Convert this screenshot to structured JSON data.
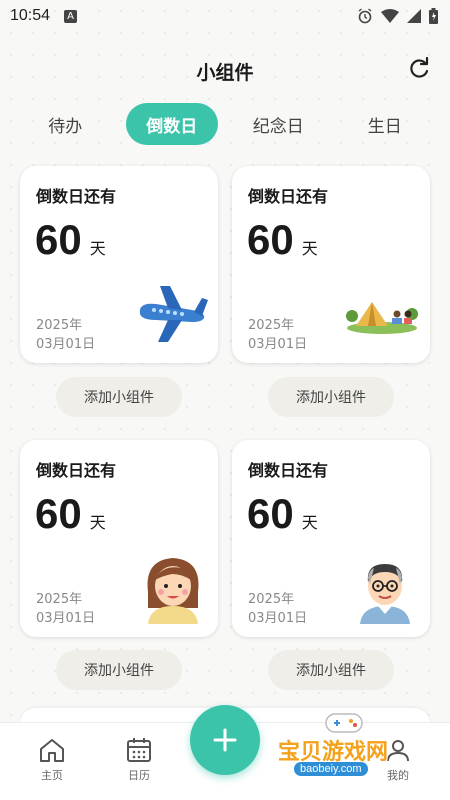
{
  "status_bar": {
    "time": "10:54",
    "a_icon": "A"
  },
  "header": {
    "title": "小组件",
    "refresh_icon": "refresh-icon"
  },
  "tabs": [
    {
      "label": "待办",
      "active": false
    },
    {
      "label": "倒数日",
      "active": true
    },
    {
      "label": "纪念日",
      "active": false
    },
    {
      "label": "生日",
      "active": false
    }
  ],
  "cards": [
    {
      "title": "倒数日还有",
      "count": "60",
      "unit": "天",
      "year": "2025年",
      "date": "03月01日",
      "illustration": "airplane"
    },
    {
      "title": "倒数日还有",
      "count": "60",
      "unit": "天",
      "year": "2025年",
      "date": "03月01日",
      "illustration": "camping"
    },
    {
      "title": "倒数日还有",
      "count": "60",
      "unit": "天",
      "year": "2025年",
      "date": "03月01日",
      "illustration": "girl"
    },
    {
      "title": "倒数日还有",
      "count": "60",
      "unit": "天",
      "year": "2025年",
      "date": "03月01日",
      "illustration": "old-man"
    }
  ],
  "add_widget_label": "添加小组件",
  "bottom_nav": [
    {
      "label": "主页",
      "icon": "home-icon"
    },
    {
      "label": "日历",
      "icon": "calendar-icon"
    },
    {
      "label": "我的",
      "icon": "profile-icon"
    }
  ],
  "fab_icon": "plus-icon",
  "watermark": {
    "text": "宝贝游戏网",
    "url": "baobeiy.com"
  },
  "colors": {
    "accent": "#3cc4aa",
    "background": "#f8f8f6",
    "card": "#ffffff",
    "add_button": "#efeee9"
  }
}
